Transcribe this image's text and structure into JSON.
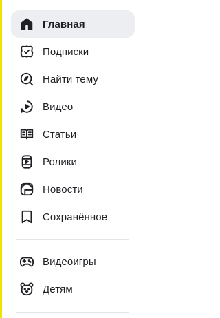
{
  "colors": {
    "accent": "#f2e200",
    "active_bg": "#eceef2",
    "text": "#1f1f24",
    "divider": "#e3e4e8"
  },
  "nav": {
    "primary": [
      {
        "label": "Главная",
        "icon": "home-icon",
        "active": true
      },
      {
        "label": "Подписки",
        "icon": "subscriptions-icon",
        "active": false
      },
      {
        "label": "Найти тему",
        "icon": "explore-icon",
        "active": false
      },
      {
        "label": "Видео",
        "icon": "video-icon",
        "active": false
      },
      {
        "label": "Статьи",
        "icon": "articles-icon",
        "active": false
      },
      {
        "label": "Ролики",
        "icon": "shorts-icon",
        "active": false
      },
      {
        "label": "Новости",
        "icon": "news-icon",
        "active": false
      },
      {
        "label": "Сохранённое",
        "icon": "bookmark-icon",
        "active": false
      }
    ],
    "secondary": [
      {
        "label": "Видеоигры",
        "icon": "gamepad-icon",
        "active": false
      },
      {
        "label": "Детям",
        "icon": "kids-bear-icon",
        "active": false
      }
    ]
  }
}
